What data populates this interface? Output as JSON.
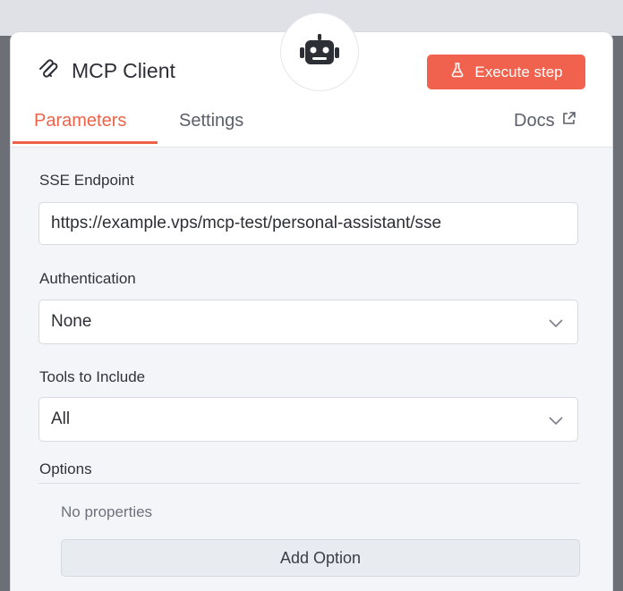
{
  "node": {
    "title": "MCP Client",
    "node_icon": "robot-icon",
    "title_icon": "mcp-logo-icon"
  },
  "header": {
    "execute_label": "Execute step",
    "execute_icon": "flask-icon",
    "accent_color": "#f0624e"
  },
  "tabs": {
    "parameters": "Parameters",
    "settings": "Settings",
    "docs": "Docs",
    "docs_icon": "external-link-icon",
    "active": "Parameters"
  },
  "fields": {
    "sse_endpoint": {
      "label": "SSE Endpoint",
      "value": "https://example.vps/mcp-test/personal-assistant/sse"
    },
    "authentication": {
      "label": "Authentication",
      "value": "None"
    },
    "tools_to_include": {
      "label": "Tools to Include",
      "value": "All"
    }
  },
  "options": {
    "label": "Options",
    "empty_text": "No properties",
    "add_label": "Add Option"
  }
}
